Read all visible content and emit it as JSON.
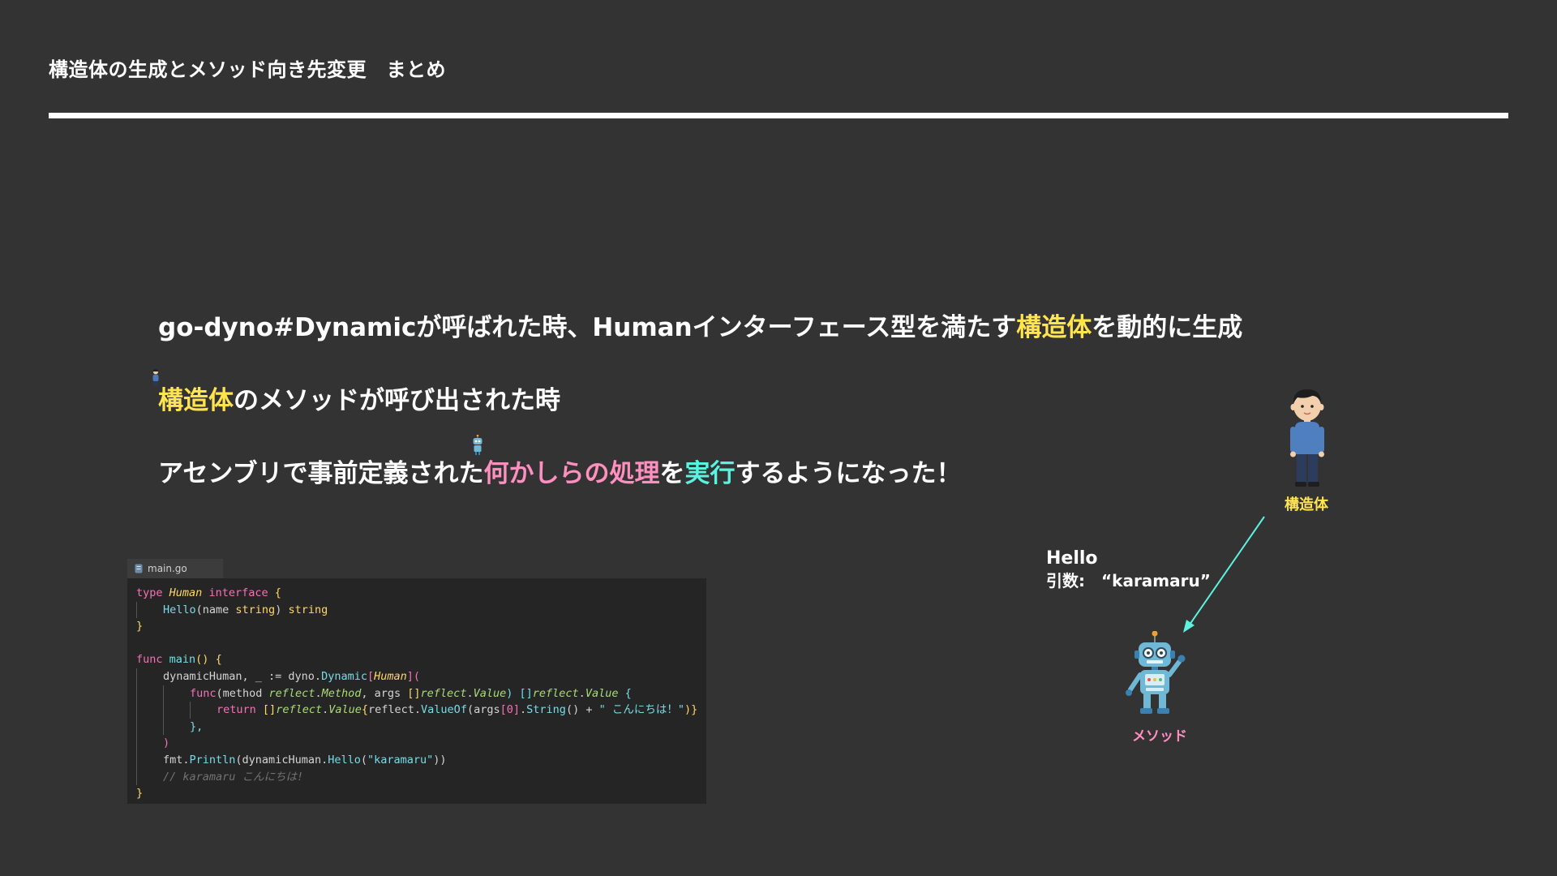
{
  "slide": {
    "title": "構造体の生成とメソッド向き先変更　まとめ",
    "line1": {
      "part1": "go-dyno#Dynamicが呼ばれた時、Humanインターフェース型を満たす",
      "highlight": "構造体",
      "part2": "を動的に生成"
    },
    "line2": {
      "highlight": "構造体",
      "part1": "のメソッドが呼び出された時"
    },
    "line3": {
      "part1": "アセンブリで事前定義された",
      "highlight_pink": "何かしらの処理",
      "part2": "を",
      "highlight_cyan": "実行",
      "part3": "するようになった！"
    }
  },
  "editor": {
    "tab_label": "main.go",
    "code": {
      "r1": {
        "kw": "type",
        "ty": "Human",
        "kw2": "interface",
        "br": "{"
      },
      "r2": {
        "fn": "Hello",
        "p1": "(name ",
        "kw": "string",
        "p2": ") ",
        "kw2": "string"
      },
      "r3": {
        "br": "}"
      },
      "r5": {
        "kw": "func",
        "fn": "main",
        "p": "()",
        "br": "{"
      },
      "r6": {
        "p1": "dynamicHuman, _ := dyno.",
        "fn": "Dynamic",
        "b1": "[",
        "ty": "Human",
        "b2": "](",
        "b3": ""
      },
      "r7": {
        "kw": "func",
        "p1": "(method ",
        "it1": "reflect",
        "d1": ".",
        "it2": "Method",
        "p2": ", args ",
        "b1": "[]",
        "it3": "reflect",
        "d2": ".",
        "it4": "Value",
        "p3": ") ",
        "b2": "[]",
        "it5": "reflect",
        "d3": ".",
        "it6": "Value",
        "br": "{"
      },
      "r8": {
        "kw": "return",
        "b1": "[]",
        "it1": "reflect",
        "d1": ".",
        "it2": "Value",
        "b2": "{",
        "p1": "reflect.",
        "fn": "ValueOf",
        "p2": "(args",
        "b3": "[",
        "num": "0",
        "b4": "]",
        "p3": ".",
        "fn2": "String",
        "p4": "() + ",
        "st": "\" こんにちは！\"",
        "b5": ")}"
      },
      "r9": {
        "p": "},"
      },
      "r10": {
        "p": ")"
      },
      "r11": {
        "p1": "fmt.",
        "fn": "Println",
        "p2": "(dynamicHuman.",
        "fn2": "Hello",
        "p3": "(",
        "st": "\"karamaru\"",
        "p4": "))"
      },
      "r12": {
        "cm": "// karamaru こんにちは!"
      },
      "r13": {
        "br": "}"
      }
    }
  },
  "diagram": {
    "struct_label": "構造体",
    "method_label": "メソッド",
    "call_label": "Hello",
    "arg_label": "引数:",
    "arg_value": "“karamaru”",
    "arrow_color": "#5cf2e0"
  }
}
